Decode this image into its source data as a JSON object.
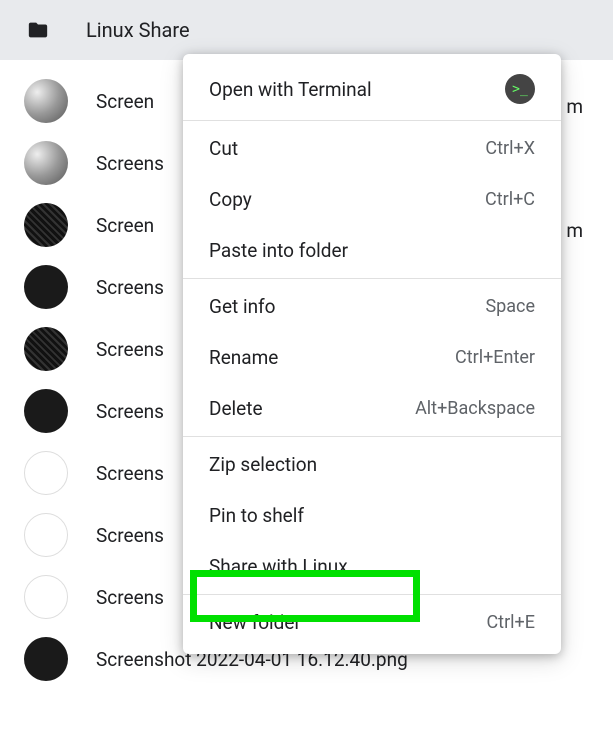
{
  "header": {
    "title": "Linux Share"
  },
  "files": [
    {
      "name": "Screen",
      "trail": "m"
    },
    {
      "name": "Screens",
      "trail": ""
    },
    {
      "name": "Screen",
      "trail": "m"
    },
    {
      "name": "Screens",
      "trail": ""
    },
    {
      "name": "Screens",
      "trail": ""
    },
    {
      "name": "Screens",
      "trail": ""
    },
    {
      "name": "Screens",
      "trail": ""
    },
    {
      "name": "Screens",
      "trail": ""
    },
    {
      "name": "Screens",
      "trail": ""
    },
    {
      "name_full": "Screenshot 2022-04-01 16.12.40.png",
      "trail": ""
    }
  ],
  "menu": {
    "open_terminal": "Open with Terminal",
    "cut": "Cut",
    "cut_sc": "Ctrl+X",
    "copy": "Copy",
    "copy_sc": "Ctrl+C",
    "paste": "Paste into folder",
    "getinfo": "Get info",
    "getinfo_sc": "Space",
    "rename": "Rename",
    "rename_sc": "Ctrl+Enter",
    "delete": "Delete",
    "delete_sc": "Alt+Backspace",
    "zip": "Zip selection",
    "pin": "Pin to shelf",
    "share_linux": "Share with Linux",
    "new_folder": "New folder",
    "new_folder_sc": "Ctrl+E"
  }
}
